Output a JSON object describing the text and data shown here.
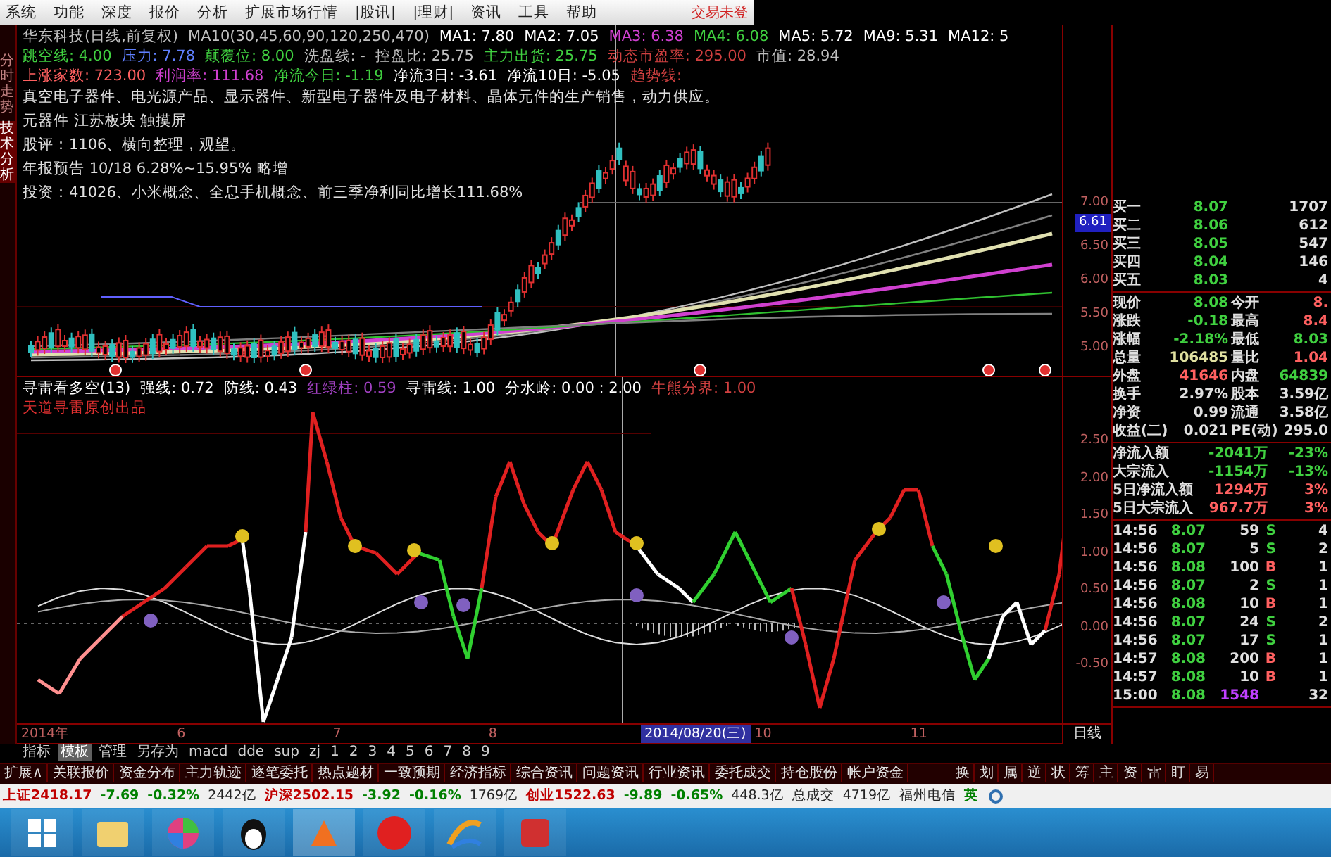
{
  "menu": {
    "items": [
      "系统",
      "功能",
      "深度",
      "报价",
      "分析",
      "扩展市场行情",
      "|股讯|",
      "|理财|",
      "资讯",
      "工具",
      "帮助"
    ],
    "login_status": "交易未登"
  },
  "side_tabs": [
    {
      "label": "分时走势",
      "selected": false
    },
    {
      "label": "技术分析",
      "selected": true
    }
  ],
  "price_panel": {
    "header_rows": [
      [
        {
          "text": "华东科技(日线,前复权)",
          "color": "#c0c0c0"
        },
        {
          "text": "MA10(30,45,60,90,120,250,470)",
          "color": "#c0c0c0"
        },
        {
          "text": "MA1: 7.80",
          "color": "#ffffff"
        },
        {
          "text": "MA2: 7.05",
          "color": "#ffffff"
        },
        {
          "text": "MA3: 6.38",
          "color": "#d040d0"
        },
        {
          "text": "MA4: 6.08",
          "color": "#40d040"
        },
        {
          "text": "MA5: 5.72",
          "color": "#ffffff"
        },
        {
          "text": "MA9: 5.31",
          "color": "#ffffff"
        },
        {
          "text": "MA12: 5",
          "color": "#ffffff"
        }
      ],
      [
        {
          "text": "跳空线: 4.00",
          "color": "#40d040"
        },
        {
          "text": "压力: 7.78",
          "color": "#6080ff"
        },
        {
          "text": "颠覆位: 8.00",
          "color": "#40d040"
        },
        {
          "text": "洗盘线: -",
          "color": "#c0c0c0"
        },
        {
          "text": "控盘比: 25.75",
          "color": "#c0c0c0"
        },
        {
          "text": "主力出货: 25.75",
          "color": "#40d040"
        },
        {
          "text": "动态市盈率: 295.00",
          "color": "#d04040"
        },
        {
          "text": "市值: 28.94",
          "color": "#c0c0c0"
        }
      ],
      [
        {
          "text": "上涨家数: 723.00",
          "color": "#ff6060"
        },
        {
          "text": "利润率: 111.68",
          "color": "#d040d0"
        },
        {
          "text": "净流今日: -1.19",
          "color": "#40d040"
        },
        {
          "text": "净流3日: -3.61",
          "color": "#ffffff"
        },
        {
          "text": "净流10日: -5.05",
          "color": "#ffffff"
        },
        {
          "text": "趋势线:",
          "color": "#d04040"
        }
      ]
    ],
    "notes": [
      "真空电子器件、电光源产品、显示器件、新型电子器件及电子材料、晶体元件的生产销售，动力供应。",
      "元器件 江苏板块 触摸屏",
      "股评：1106、横向整理，观望。",
      "年报预告 10/18 6.28%~15.95% 略增",
      "投资：41026、小米概念、全息手机概念、前三季净利同比增长111.68%"
    ],
    "axis": [
      {
        "label": "7.00",
        "kind": "tick"
      },
      {
        "label": "6.61",
        "kind": "tag"
      },
      {
        "label": "6.50",
        "kind": "tick"
      },
      {
        "label": "6.00",
        "kind": "tick"
      },
      {
        "label": "5.50",
        "kind": "tick"
      },
      {
        "label": "5.00",
        "kind": "tick"
      }
    ]
  },
  "indicator_panel": {
    "header": [
      {
        "text": "寻雷看多空(13)",
        "color": "#ffffff"
      },
      {
        "text": "强线: 0.72",
        "color": "#ffffff"
      },
      {
        "text": "防线: 0.43",
        "color": "#ffffff"
      },
      {
        "text": "红绿柱: 0.59",
        "color": "#a040c0"
      },
      {
        "text": "寻雷线: 1.00",
        "color": "#ffffff"
      },
      {
        "text": "分水岭: 0.00 : 2.00",
        "color": "#ffffff"
      },
      {
        "text": "牛熊分界: 1.00",
        "color": "#d04040"
      }
    ],
    "subtitle": "天道寻雷原创出品",
    "axis": [
      "2.50",
      "2.00",
      "1.50",
      "1.00",
      "0.50",
      "0.00",
      "-0.50"
    ]
  },
  "date_axis": {
    "labels": [
      {
        "text": "2014年",
        "selected": false
      },
      {
        "text": "6",
        "selected": false
      },
      {
        "text": "7",
        "selected": false
      },
      {
        "text": "8",
        "selected": false
      },
      {
        "text": "2014/08/20(三)",
        "selected": true
      },
      {
        "text": "10",
        "selected": false
      },
      {
        "text": "11",
        "selected": false
      }
    ],
    "period": "日线"
  },
  "quote": {
    "order_book": [
      {
        "label": "买一",
        "price": "8.07",
        "volume": "1707"
      },
      {
        "label": "买二",
        "price": "8.06",
        "volume": "612"
      },
      {
        "label": "买三",
        "price": "8.05",
        "volume": "547"
      },
      {
        "label": "买四",
        "price": "8.04",
        "volume": "146"
      },
      {
        "label": "买五",
        "price": "8.03",
        "volume": "4"
      }
    ],
    "stats": [
      [
        {
          "label": "现价",
          "value": "8.08",
          "color": "#40d040"
        },
        {
          "label": "今开",
          "value": "8.",
          "color": "#ff6060"
        }
      ],
      [
        {
          "label": "涨跌",
          "value": "-0.18",
          "color": "#40d040"
        },
        {
          "label": "最高",
          "value": "8.4",
          "color": "#ff6060"
        }
      ],
      [
        {
          "label": "涨幅",
          "value": "-2.18%",
          "color": "#40d040"
        },
        {
          "label": "最低",
          "value": "8.03",
          "color": "#40d040"
        }
      ],
      [
        {
          "label": "总量",
          "value": "106485",
          "color": "#e0e0a0"
        },
        {
          "label": "量比",
          "value": "1.04",
          "color": "#ff6060"
        }
      ],
      [
        {
          "label": "外盘",
          "value": "41646",
          "color": "#ff6060"
        },
        {
          "label": "内盘",
          "value": "64839",
          "color": "#40d040"
        }
      ],
      [
        {
          "label": "换手",
          "value": "2.97%",
          "color": "#e0e0e0"
        },
        {
          "label": "股本",
          "value": "3.59亿",
          "color": "#e0e0e0"
        }
      ],
      [
        {
          "label": "净资",
          "value": "0.99",
          "color": "#e0e0e0"
        },
        {
          "label": "流通",
          "value": "3.58亿",
          "color": "#e0e0e0"
        }
      ],
      [
        {
          "label": "收益(二)",
          "value": "0.021",
          "color": "#e0e0e0"
        },
        {
          "label": "PE(动)",
          "value": "295.0",
          "color": "#e0e0e0"
        }
      ]
    ],
    "flows": [
      {
        "label": "净流入额",
        "value": "-2041万",
        "share": "-23%",
        "color": "#40d040"
      },
      {
        "label": "大宗流入",
        "value": "-1154万",
        "share": "-13%",
        "color": "#40d040"
      },
      {
        "label": "5日净流入额",
        "value": "1294万",
        "share": "3%",
        "color": "#ff6060"
      },
      {
        "label": "5日大宗流入",
        "value": "967.7万",
        "share": "3%",
        "color": "#ff6060"
      }
    ],
    "ticks": [
      {
        "kind": "trade",
        "time": "14:56",
        "price": "8.07",
        "volume": "59",
        "side": "S",
        "count": "4",
        "buy": false
      },
      {
        "kind": "trade",
        "time": "14:56",
        "price": "8.07",
        "volume": "5",
        "side": "S",
        "count": "2",
        "buy": false
      },
      {
        "kind": "trade",
        "time": "14:56",
        "price": "8.08",
        "volume": "100",
        "side": "B",
        "count": "1",
        "buy": true
      },
      {
        "kind": "trade",
        "time": "14:56",
        "price": "8.07",
        "volume": "2",
        "side": "S",
        "count": "1",
        "buy": false
      },
      {
        "kind": "trade",
        "time": "14:56",
        "price": "8.08",
        "volume": "10",
        "side": "B",
        "count": "1",
        "buy": true
      },
      {
        "kind": "trade",
        "time": "14:56",
        "price": "8.07",
        "volume": "24",
        "side": "S",
        "count": "2",
        "buy": false
      },
      {
        "kind": "trade",
        "time": "14:56",
        "price": "8.07",
        "volume": "17",
        "side": "S",
        "count": "1",
        "buy": false
      },
      {
        "kind": "trade",
        "time": "14:57",
        "price": "8.08",
        "volume": "200",
        "side": "B",
        "count": "1",
        "buy": true
      },
      {
        "kind": "trade",
        "time": "14:57",
        "price": "8.08",
        "volume": "10",
        "side": "B",
        "count": "1",
        "buy": true
      },
      {
        "kind": "summary",
        "time": "15:00",
        "price": "8.08",
        "volume": "1548",
        "count": "32"
      }
    ]
  },
  "tabs": [
    {
      "label": "指标",
      "selected": false
    },
    {
      "label": "模板",
      "selected": true
    },
    {
      "label": "管理",
      "selected": false
    },
    {
      "label": "另存为",
      "selected": false
    },
    {
      "label": "macd",
      "selected": false
    },
    {
      "label": "dde",
      "selected": false
    },
    {
      "label": "sup",
      "selected": false
    },
    {
      "label": "zj",
      "selected": false
    },
    {
      "label": "1",
      "selected": false
    },
    {
      "label": "2",
      "selected": false
    },
    {
      "label": "3",
      "selected": false
    },
    {
      "label": "4",
      "selected": false
    },
    {
      "label": "5",
      "selected": false
    },
    {
      "label": "6",
      "selected": false
    },
    {
      "label": "7",
      "selected": false
    },
    {
      "label": "8",
      "selected": false
    },
    {
      "label": "9",
      "selected": false
    }
  ],
  "function_bar": {
    "left": [
      "扩展∧",
      "关联报价",
      "资金分布",
      "主力轨迹",
      "逐笔委托",
      "热点题材",
      "一致预期",
      "经济指标",
      "综合资讯",
      "问题资讯",
      "行业资讯",
      "委托成交",
      "持仓股份",
      "帐户资金"
    ],
    "right": [
      "换",
      "划",
      "属",
      "逆",
      "状",
      "筹",
      "主",
      "资",
      "雷",
      "盯",
      "易"
    ]
  },
  "status_bar": {
    "indices": [
      {
        "name": "上证",
        "value": "2418.17",
        "change": "-7.69",
        "percent": "-0.32%",
        "amount": "2442亿"
      },
      {
        "name": "沪深",
        "value": "2502.15",
        "change": "-3.92",
        "percent": "-0.16%",
        "amount": "1769亿"
      },
      {
        "name": "创业",
        "value": "1522.63",
        "change": "-9.89",
        "percent": "-0.65%",
        "amount": "448.3亿"
      }
    ],
    "total_label": "总成交",
    "total": "4719亿",
    "network": "福州电信",
    "lang": "英"
  }
}
